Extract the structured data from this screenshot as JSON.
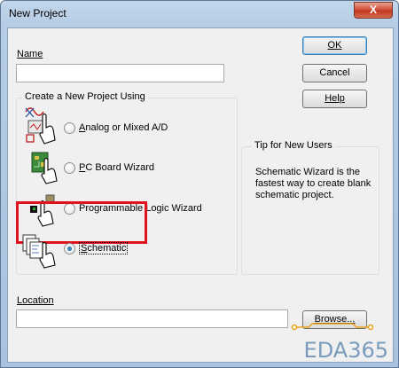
{
  "window": {
    "title": "New Project",
    "close_glyph": "X"
  },
  "name": {
    "label": "Name",
    "value": ""
  },
  "buttons": {
    "ok": "OK",
    "cancel": "Cancel",
    "help": "Help",
    "browse": "Browse..."
  },
  "create_group": {
    "title": "Create a New Project Using",
    "options": [
      {
        "label": "Analog or Mixed A/D",
        "icon": "analog-simulation-icon",
        "selected": false
      },
      {
        "label": "PC Board Wizard",
        "icon": "pcb-board-icon",
        "selected": false
      },
      {
        "label": "Programmable Logic Wizard",
        "icon": "programmable-logic-icon",
        "selected": false
      },
      {
        "label": "Schematic",
        "icon": "schematic-icon",
        "selected": true
      }
    ]
  },
  "tip": {
    "title": "Tip for New Users",
    "text": "Schematic Wizard is the fastest way to create blank schematic project."
  },
  "location": {
    "label": "Location",
    "value": ""
  },
  "watermark": "EDA365",
  "colors": {
    "highlight": "#e0141c",
    "close": "#c2381f",
    "radio_dot": "#1d5b86"
  }
}
